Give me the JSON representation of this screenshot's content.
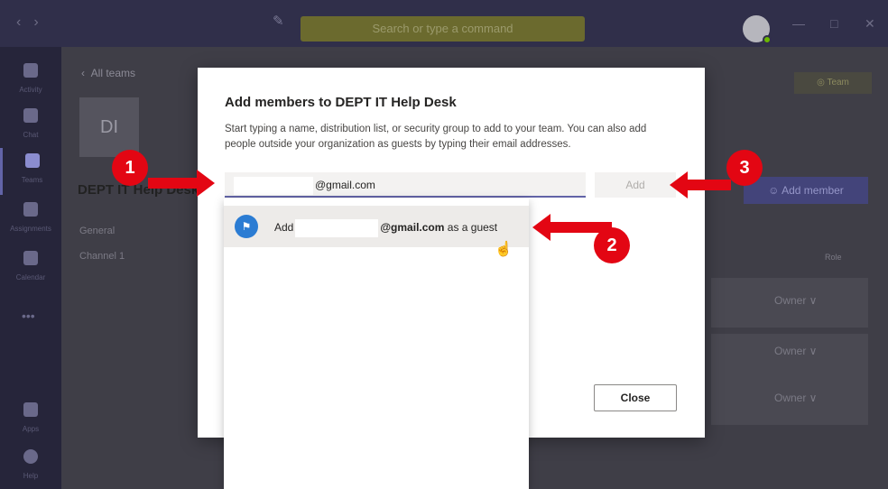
{
  "app": {
    "search_placeholder": "Search or type a command"
  },
  "rail": {
    "items": [
      {
        "label": "Activity"
      },
      {
        "label": "Chat"
      },
      {
        "label": "Teams"
      },
      {
        "label": "Assignments"
      },
      {
        "label": "Calendar"
      },
      {
        "label": "Apps"
      },
      {
        "label": "Help"
      }
    ]
  },
  "team_page": {
    "back_link": "All teams",
    "logo_initials": "DI",
    "team_name": "DEPT IT Help Desk",
    "team_badge": "Team",
    "channels": [
      "General",
      "Channel 1"
    ],
    "add_member_label": "Add member",
    "role_header": "Role",
    "roles": [
      "Owner",
      "Owner",
      "Owner"
    ]
  },
  "dialog": {
    "title": "Add members to DEPT IT Help Desk",
    "description": "Start typing a name, distribution list, or security group to add to your team. You can also add people outside your organization as guests by typing their email addresses.",
    "input_value_suffix": "@gmail.com",
    "add_button": "Add",
    "close_button": "Close"
  },
  "suggestion": {
    "prefix": "Add",
    "email_suffix": "@gmail.com",
    "suffix": "as a guest"
  },
  "annotations": [
    "1",
    "2",
    "3"
  ],
  "colors": {
    "accent": "#6264a7",
    "annotation": "#e30613"
  }
}
